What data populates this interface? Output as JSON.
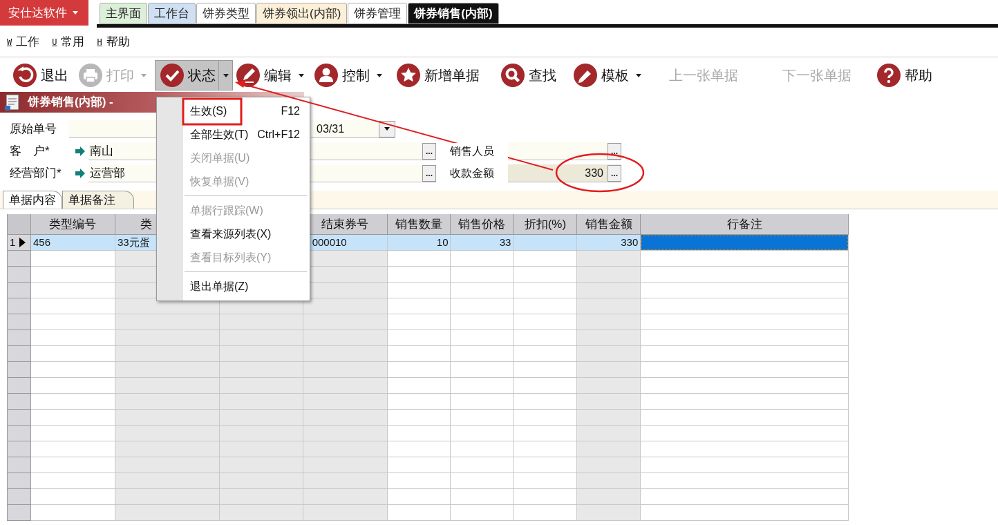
{
  "app_button": {
    "label": "安仕达软件"
  },
  "tabs": [
    {
      "label": "主界面",
      "selected": false,
      "color": "#dcefd9"
    },
    {
      "label": "工作台",
      "selected": false,
      "color": "#cfe0f3"
    },
    {
      "label": "饼券类型",
      "selected": false,
      "color": "#ffffff"
    },
    {
      "label": "饼券领出(内部)",
      "selected": false,
      "color": "#fdf0d9"
    },
    {
      "label": "饼券管理",
      "selected": false,
      "color": "#ffffff"
    },
    {
      "label": "饼券销售(内部)",
      "selected": true,
      "color": "#111111"
    }
  ],
  "menu_bar": [
    {
      "key": "W",
      "label": "工作"
    },
    {
      "key": "U",
      "label": "常用"
    },
    {
      "key": "H",
      "label": "帮助"
    }
  ],
  "toolbar": [
    {
      "label": "退出",
      "dropdown": false,
      "disabled": false,
      "pressed": false
    },
    {
      "label": "打印",
      "dropdown": true,
      "disabled": true,
      "pressed": false
    },
    {
      "label": "状态",
      "dropdown": true,
      "disabled": false,
      "pressed": true
    },
    {
      "label": "编辑",
      "dropdown": true,
      "disabled": false,
      "pressed": false
    },
    {
      "label": "控制",
      "dropdown": true,
      "disabled": false,
      "pressed": false
    },
    {
      "label": "新增单据",
      "dropdown": false,
      "disabled": false,
      "pressed": false
    },
    {
      "label": "查找",
      "dropdown": false,
      "disabled": false,
      "pressed": false
    },
    {
      "label": "模板",
      "dropdown": true,
      "disabled": false,
      "pressed": false
    },
    {
      "label": "上一张单据",
      "dropdown": false,
      "disabled": true,
      "pressed": false
    },
    {
      "label": "下一张单据",
      "dropdown": false,
      "disabled": true,
      "pressed": false
    },
    {
      "label": "帮助",
      "dropdown": false,
      "disabled": false,
      "pressed": false
    }
  ],
  "document": {
    "title": "饼券销售(内部) -"
  },
  "form": {
    "original_no": {
      "label": "原始单号"
    },
    "date": {
      "value": "03/31"
    },
    "customer": {
      "label": "客　户*",
      "value": "南山",
      "button": "..."
    },
    "salesperson": {
      "label": "销售人员",
      "button": "..."
    },
    "department": {
      "label": "经营部门*",
      "value": "运营部",
      "button": "..."
    },
    "amount": {
      "label": "收款金额",
      "value": "330",
      "button": "..."
    }
  },
  "form_tabs": [
    {
      "label": "单据内容",
      "selected": true
    },
    {
      "label": "单据备注",
      "selected": false
    }
  ],
  "grid": {
    "columns": [
      "类型编号",
      "类",
      null,
      "结束券号",
      "销售数量",
      "销售价格",
      "折扣(%)",
      "销售金额",
      "行备注"
    ],
    "rows": [
      {
        "number": "1",
        "current": true,
        "cells": [
          {
            "text": "456",
            "selected": false
          },
          {
            "text": "33元蛋",
            "selected": false
          },
          {
            "text": null
          },
          {
            "text": "000010",
            "selected": false
          },
          {
            "text": "10",
            "selected": false
          },
          {
            "text": "33",
            "selected": false
          },
          {
            "text": null,
            "selected": false
          },
          {
            "text": "330",
            "selected": false
          },
          {
            "text": null,
            "selected": true
          }
        ]
      }
    ]
  },
  "context_menu": [
    {
      "kind": "item",
      "label": "生效(S)",
      "shortcut": "F12",
      "disabled": false
    },
    {
      "kind": "item",
      "label": "全部生效(T)",
      "shortcut": "Ctrl+F12",
      "disabled": false
    },
    {
      "kind": "item",
      "label": "关闭单据(U)",
      "disabled": true
    },
    {
      "kind": "item",
      "label": "恢复单据(V)",
      "disabled": true
    },
    {
      "kind": "separator"
    },
    {
      "kind": "item",
      "label": "单据行跟踪(W)",
      "disabled": true
    },
    {
      "kind": "item",
      "label": "查看来源列表(X)",
      "disabled": false
    },
    {
      "kind": "item",
      "label": "查看目标列表(Y)",
      "disabled": true
    },
    {
      "kind": "separator"
    },
    {
      "kind": "item",
      "label": "退出单据(Z)",
      "disabled": false
    }
  ]
}
